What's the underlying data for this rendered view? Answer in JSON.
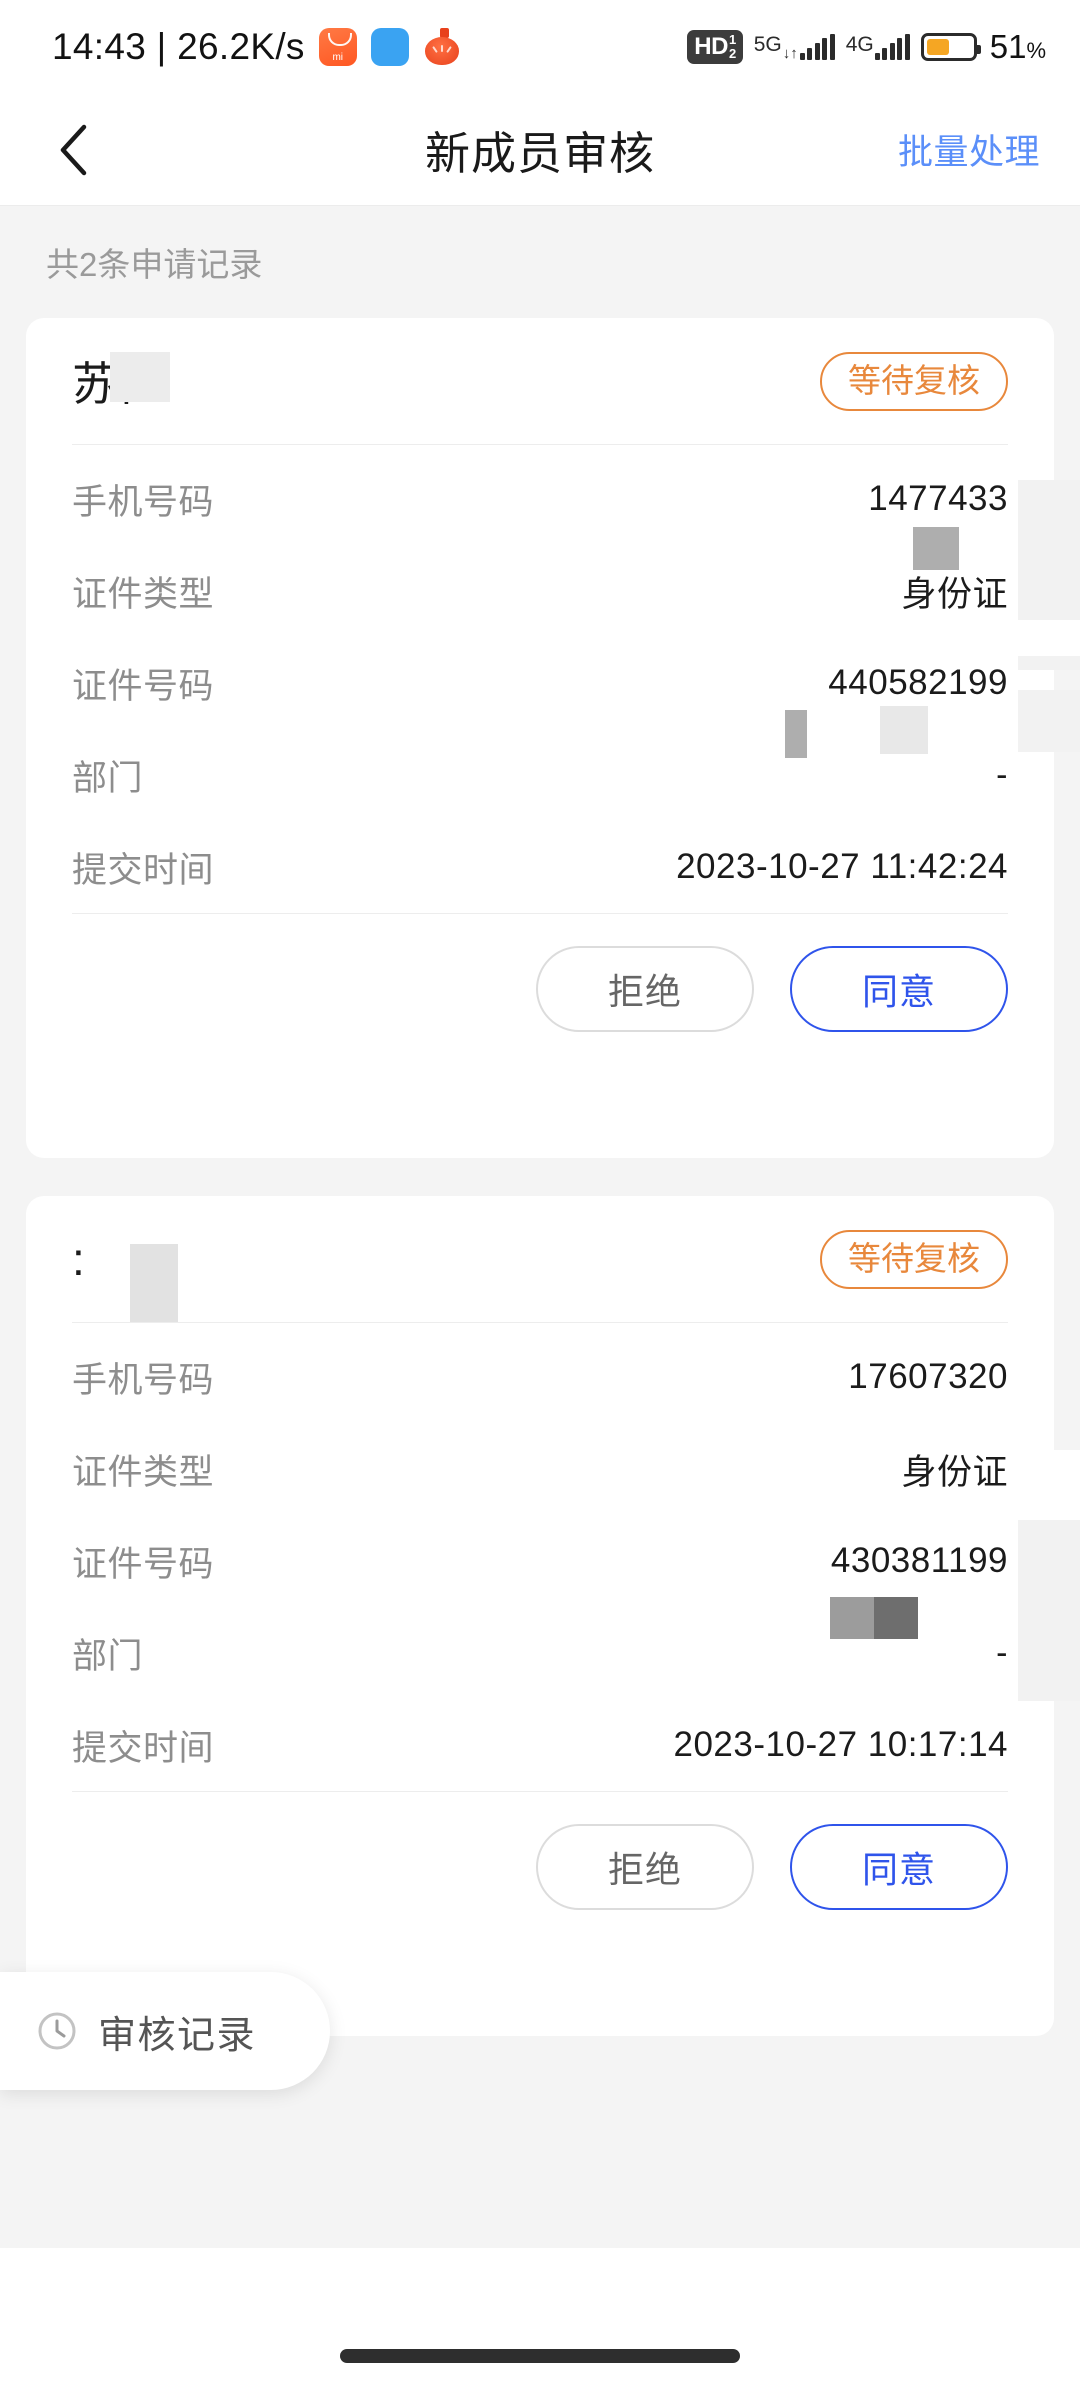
{
  "status_bar": {
    "clock": "14:43 | 26.2K/s",
    "apps": [
      "xiaomi-store-icon",
      "blue-wallet-icon",
      "tomato-icon"
    ],
    "hd_badge": "HD",
    "hd_sup": "1",
    "hd_sub": "2",
    "net_5g": "5G",
    "net_4g": "4G",
    "battery_percent": "51",
    "battery_percent_symbol": "%",
    "battery_level": 51
  },
  "nav": {
    "back_icon": "chevron-left-icon",
    "title": "新成员审核",
    "action_label": "批量处理"
  },
  "list": {
    "summary": "共2条申请记录"
  },
  "labels": {
    "phone": "手机号码",
    "id_type": "证件类型",
    "id_number": "证件号码",
    "department": "部门",
    "submit_time": "提交时间"
  },
  "buttons": {
    "reject": "拒绝",
    "agree": "同意"
  },
  "fab": {
    "icon": "clock-icon",
    "label": "审核记录"
  },
  "colors": {
    "accent_blue": "#2f54eb",
    "link_blue": "#5b8ff9",
    "status_orange": "#e8883c",
    "page_bg": "#f4f4f4",
    "card_bg": "#ffffff",
    "battery_orange": "#f5a623"
  },
  "cards": [
    {
      "name": "苏阝",
      "status": "等待复核",
      "phone": "1477433",
      "id_type": "身份证",
      "id_number": "440582199",
      "department": "-",
      "submit_time": "2023-10-27 11:42:24",
      "reject": "拒绝",
      "agree": "同意"
    },
    {
      "name": ":",
      "status": "等待复核",
      "phone": "17607320",
      "id_type": "身份证",
      "id_number": "430381199",
      "department": "-",
      "submit_time": "2023-10-27 10:17:14",
      "reject": "拒绝",
      "agree": "同意"
    }
  ]
}
